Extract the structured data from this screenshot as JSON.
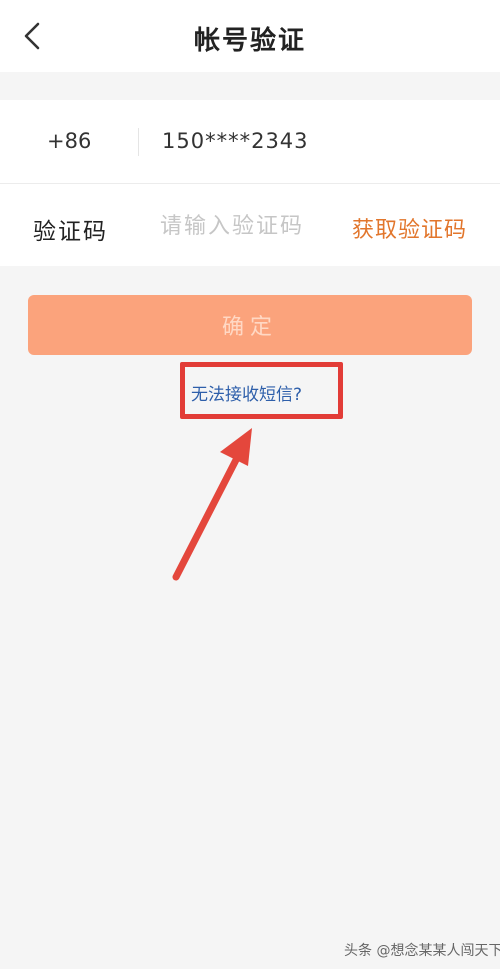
{
  "nav": {
    "title": "帐号验证",
    "back_icon": "chevron-left-icon"
  },
  "phone_row": {
    "country_code": "+86",
    "phone_number": "150****2343"
  },
  "code_row": {
    "label": "验证码",
    "input_value": "",
    "input_placeholder": "请输入验证码",
    "get_code_label": "获取验证码"
  },
  "confirm": {
    "label": "确定"
  },
  "help": {
    "no_sms_label": "无法接收短信?"
  },
  "annotation": {
    "highlight_color": "#e23c37",
    "arrow_color": "#e4473c"
  },
  "watermark": {
    "text": "头条 @想念某某人闯天下"
  },
  "colors": {
    "accent": "#e2762c",
    "button_bg": "#fba37c",
    "link": "#2e5faa",
    "background": "#f5f5f5"
  }
}
